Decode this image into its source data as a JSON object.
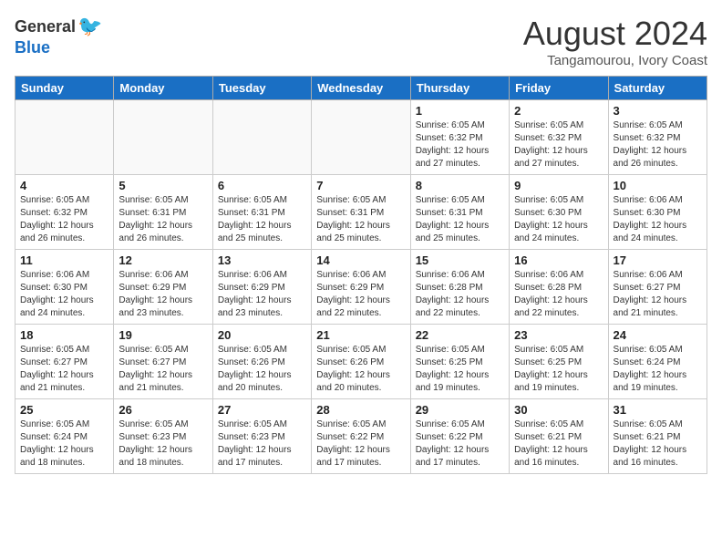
{
  "header": {
    "logo_general": "General",
    "logo_blue": "Blue",
    "month": "August 2024",
    "location": "Tangamourou, Ivory Coast"
  },
  "weekdays": [
    "Sunday",
    "Monday",
    "Tuesday",
    "Wednesday",
    "Thursday",
    "Friday",
    "Saturday"
  ],
  "weeks": [
    [
      {
        "day": "",
        "info": ""
      },
      {
        "day": "",
        "info": ""
      },
      {
        "day": "",
        "info": ""
      },
      {
        "day": "",
        "info": ""
      },
      {
        "day": "1",
        "info": "Sunrise: 6:05 AM\nSunset: 6:32 PM\nDaylight: 12 hours\nand 27 minutes."
      },
      {
        "day": "2",
        "info": "Sunrise: 6:05 AM\nSunset: 6:32 PM\nDaylight: 12 hours\nand 27 minutes."
      },
      {
        "day": "3",
        "info": "Sunrise: 6:05 AM\nSunset: 6:32 PM\nDaylight: 12 hours\nand 26 minutes."
      }
    ],
    [
      {
        "day": "4",
        "info": "Sunrise: 6:05 AM\nSunset: 6:32 PM\nDaylight: 12 hours\nand 26 minutes."
      },
      {
        "day": "5",
        "info": "Sunrise: 6:05 AM\nSunset: 6:31 PM\nDaylight: 12 hours\nand 26 minutes."
      },
      {
        "day": "6",
        "info": "Sunrise: 6:05 AM\nSunset: 6:31 PM\nDaylight: 12 hours\nand 25 minutes."
      },
      {
        "day": "7",
        "info": "Sunrise: 6:05 AM\nSunset: 6:31 PM\nDaylight: 12 hours\nand 25 minutes."
      },
      {
        "day": "8",
        "info": "Sunrise: 6:05 AM\nSunset: 6:31 PM\nDaylight: 12 hours\nand 25 minutes."
      },
      {
        "day": "9",
        "info": "Sunrise: 6:05 AM\nSunset: 6:30 PM\nDaylight: 12 hours\nand 24 minutes."
      },
      {
        "day": "10",
        "info": "Sunrise: 6:06 AM\nSunset: 6:30 PM\nDaylight: 12 hours\nand 24 minutes."
      }
    ],
    [
      {
        "day": "11",
        "info": "Sunrise: 6:06 AM\nSunset: 6:30 PM\nDaylight: 12 hours\nand 24 minutes."
      },
      {
        "day": "12",
        "info": "Sunrise: 6:06 AM\nSunset: 6:29 PM\nDaylight: 12 hours\nand 23 minutes."
      },
      {
        "day": "13",
        "info": "Sunrise: 6:06 AM\nSunset: 6:29 PM\nDaylight: 12 hours\nand 23 minutes."
      },
      {
        "day": "14",
        "info": "Sunrise: 6:06 AM\nSunset: 6:29 PM\nDaylight: 12 hours\nand 22 minutes."
      },
      {
        "day": "15",
        "info": "Sunrise: 6:06 AM\nSunset: 6:28 PM\nDaylight: 12 hours\nand 22 minutes."
      },
      {
        "day": "16",
        "info": "Sunrise: 6:06 AM\nSunset: 6:28 PM\nDaylight: 12 hours\nand 22 minutes."
      },
      {
        "day": "17",
        "info": "Sunrise: 6:06 AM\nSunset: 6:27 PM\nDaylight: 12 hours\nand 21 minutes."
      }
    ],
    [
      {
        "day": "18",
        "info": "Sunrise: 6:05 AM\nSunset: 6:27 PM\nDaylight: 12 hours\nand 21 minutes."
      },
      {
        "day": "19",
        "info": "Sunrise: 6:05 AM\nSunset: 6:27 PM\nDaylight: 12 hours\nand 21 minutes."
      },
      {
        "day": "20",
        "info": "Sunrise: 6:05 AM\nSunset: 6:26 PM\nDaylight: 12 hours\nand 20 minutes."
      },
      {
        "day": "21",
        "info": "Sunrise: 6:05 AM\nSunset: 6:26 PM\nDaylight: 12 hours\nand 20 minutes."
      },
      {
        "day": "22",
        "info": "Sunrise: 6:05 AM\nSunset: 6:25 PM\nDaylight: 12 hours\nand 19 minutes."
      },
      {
        "day": "23",
        "info": "Sunrise: 6:05 AM\nSunset: 6:25 PM\nDaylight: 12 hours\nand 19 minutes."
      },
      {
        "day": "24",
        "info": "Sunrise: 6:05 AM\nSunset: 6:24 PM\nDaylight: 12 hours\nand 19 minutes."
      }
    ],
    [
      {
        "day": "25",
        "info": "Sunrise: 6:05 AM\nSunset: 6:24 PM\nDaylight: 12 hours\nand 18 minutes."
      },
      {
        "day": "26",
        "info": "Sunrise: 6:05 AM\nSunset: 6:23 PM\nDaylight: 12 hours\nand 18 minutes."
      },
      {
        "day": "27",
        "info": "Sunrise: 6:05 AM\nSunset: 6:23 PM\nDaylight: 12 hours\nand 17 minutes."
      },
      {
        "day": "28",
        "info": "Sunrise: 6:05 AM\nSunset: 6:22 PM\nDaylight: 12 hours\nand 17 minutes."
      },
      {
        "day": "29",
        "info": "Sunrise: 6:05 AM\nSunset: 6:22 PM\nDaylight: 12 hours\nand 17 minutes."
      },
      {
        "day": "30",
        "info": "Sunrise: 6:05 AM\nSunset: 6:21 PM\nDaylight: 12 hours\nand 16 minutes."
      },
      {
        "day": "31",
        "info": "Sunrise: 6:05 AM\nSunset: 6:21 PM\nDaylight: 12 hours\nand 16 minutes."
      }
    ]
  ]
}
